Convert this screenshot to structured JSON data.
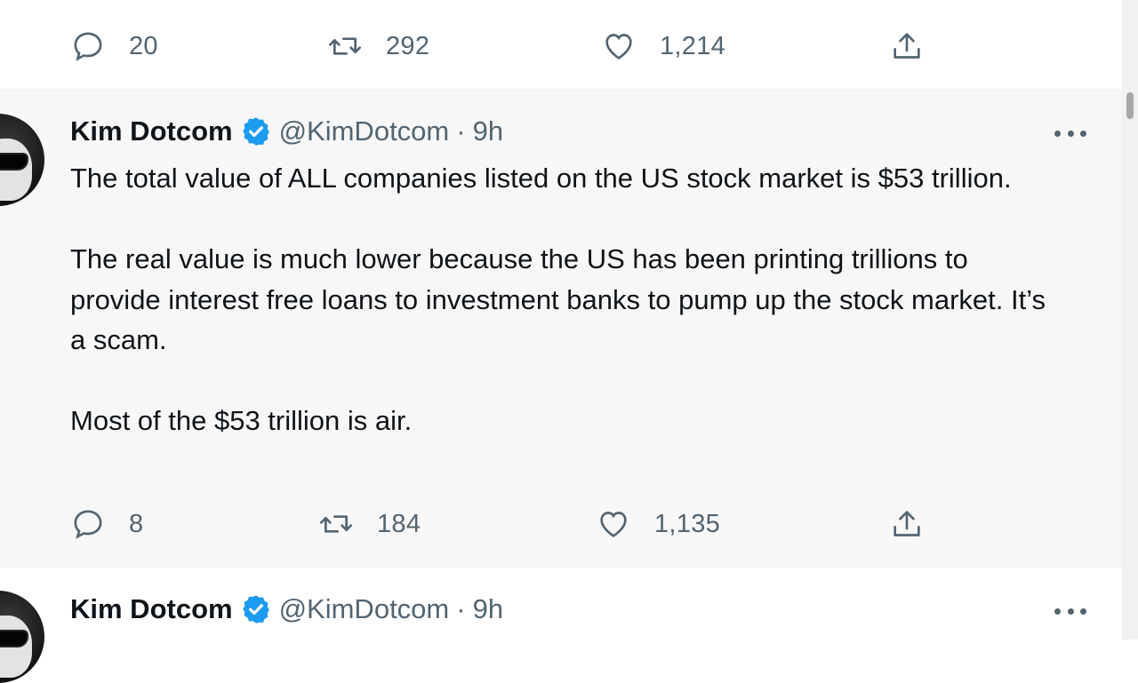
{
  "previous_tweet": {
    "replies": "20",
    "retweets": "292",
    "likes": "1,214"
  },
  "tweet": {
    "name": "Kim Dotcom",
    "handle": "@KimDotcom",
    "separator": "·",
    "time": "9h",
    "paragraphs": [
      "The total value of ALL companies listed on the US stock market is $53 trillion.",
      "The real value is much lower because the US has been printing trillions to provide interest free loans to investment banks to pump up the stock market. It’s a scam.",
      "Most of the $53 trillion is air."
    ],
    "replies": "8",
    "retweets": "184",
    "likes": "1,135"
  },
  "next_tweet": {
    "name": "Kim Dotcom",
    "handle": "@KimDotcom",
    "separator": "·",
    "time": "9h"
  },
  "colors": {
    "verified_badge": "#1d9bf0",
    "icon_gray": "#536471",
    "highlight_bg": "#f7f7f7"
  },
  "icons": [
    "reply-icon",
    "retweet-icon",
    "like-icon",
    "share-icon",
    "verified-icon",
    "more-icon"
  ]
}
